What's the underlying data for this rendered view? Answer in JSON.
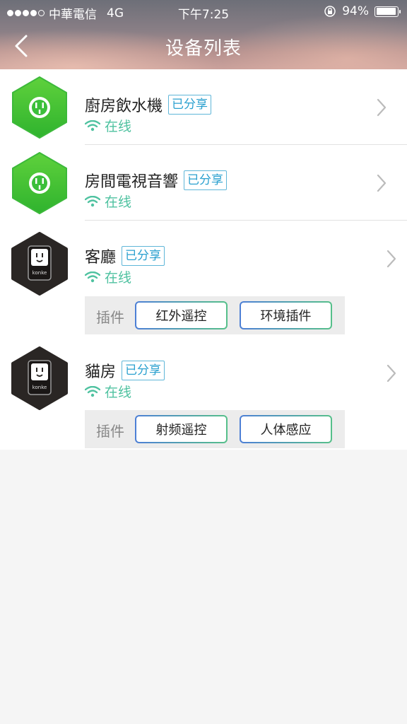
{
  "status_bar": {
    "carrier": "中華電信",
    "network": "4G",
    "time": "下午7:25",
    "battery": "94%",
    "battery_level": 0.94,
    "signal_bars": 4
  },
  "nav": {
    "title": "设备列表",
    "back_icon": "chevron-left-icon"
  },
  "colors": {
    "accent_online": "#4fc2a0",
    "badge_border": "#5fb6d8",
    "badge_text": "#2aa0cf",
    "device_green": "#3bbf3a",
    "device_dark": "#2a2624"
  },
  "devices": [
    {
      "name": "廚房飲水機",
      "badge": "已分享",
      "status": "在线",
      "icon": "green-socket-icon"
    },
    {
      "name": "房間電視音響",
      "badge": "已分享",
      "status": "在线",
      "icon": "green-socket-icon"
    },
    {
      "name": "客廳",
      "badge": "已分享",
      "status": "在线",
      "icon": "konke-socket-icon",
      "brand": "konke",
      "plugins_label": "插件",
      "plugins": [
        "红外遥控",
        "环境插件"
      ]
    },
    {
      "name": "貓房",
      "badge": "已分享",
      "status": "在线",
      "icon": "konke-socket-icon",
      "brand": "konke",
      "plugins_label": "插件",
      "plugins": [
        "射频遥控",
        "人体感应"
      ]
    }
  ]
}
